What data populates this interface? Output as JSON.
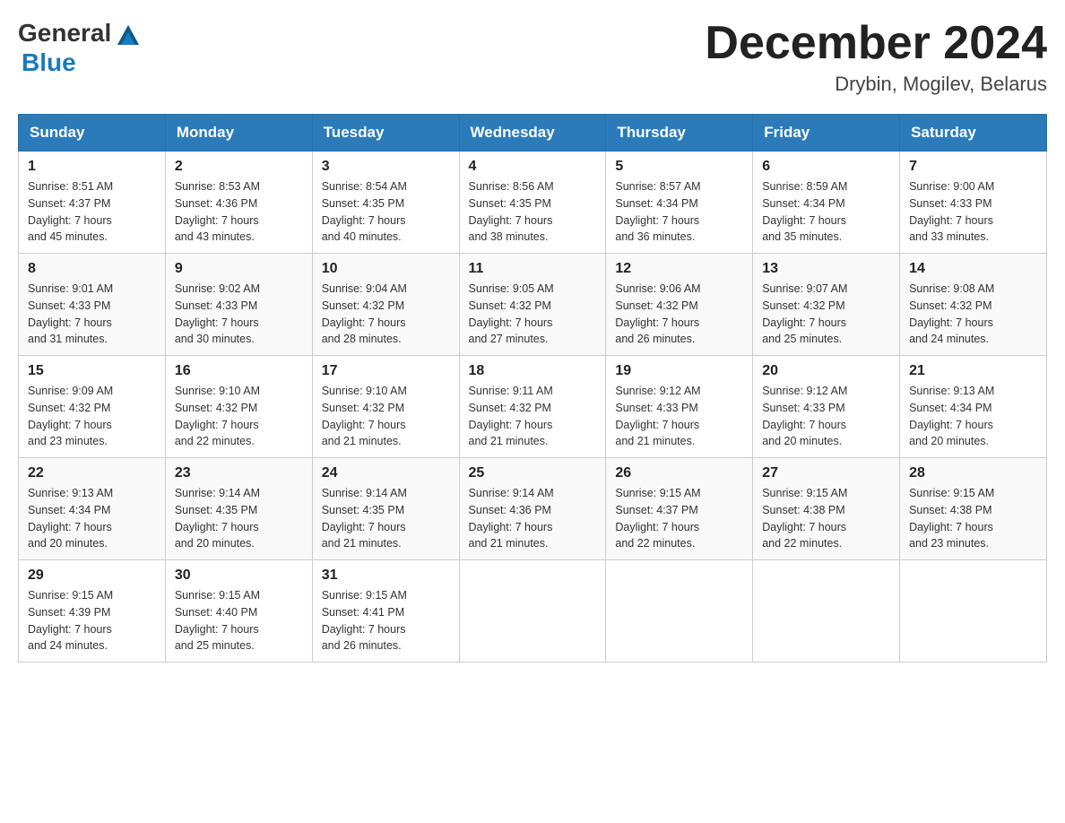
{
  "header": {
    "logo_general": "General",
    "logo_blue": "Blue",
    "month_year": "December 2024",
    "location": "Drybin, Mogilev, Belarus"
  },
  "days_of_week": [
    "Sunday",
    "Monday",
    "Tuesday",
    "Wednesday",
    "Thursday",
    "Friday",
    "Saturday"
  ],
  "weeks": [
    [
      {
        "day": "1",
        "sunrise": "8:51 AM",
        "sunset": "4:37 PM",
        "daylight": "7 hours and 45 minutes."
      },
      {
        "day": "2",
        "sunrise": "8:53 AM",
        "sunset": "4:36 PM",
        "daylight": "7 hours and 43 minutes."
      },
      {
        "day": "3",
        "sunrise": "8:54 AM",
        "sunset": "4:35 PM",
        "daylight": "7 hours and 40 minutes."
      },
      {
        "day": "4",
        "sunrise": "8:56 AM",
        "sunset": "4:35 PM",
        "daylight": "7 hours and 38 minutes."
      },
      {
        "day": "5",
        "sunrise": "8:57 AM",
        "sunset": "4:34 PM",
        "daylight": "7 hours and 36 minutes."
      },
      {
        "day": "6",
        "sunrise": "8:59 AM",
        "sunset": "4:34 PM",
        "daylight": "7 hours and 35 minutes."
      },
      {
        "day": "7",
        "sunrise": "9:00 AM",
        "sunset": "4:33 PM",
        "daylight": "7 hours and 33 minutes."
      }
    ],
    [
      {
        "day": "8",
        "sunrise": "9:01 AM",
        "sunset": "4:33 PM",
        "daylight": "7 hours and 31 minutes."
      },
      {
        "day": "9",
        "sunrise": "9:02 AM",
        "sunset": "4:33 PM",
        "daylight": "7 hours and 30 minutes."
      },
      {
        "day": "10",
        "sunrise": "9:04 AM",
        "sunset": "4:32 PM",
        "daylight": "7 hours and 28 minutes."
      },
      {
        "day": "11",
        "sunrise": "9:05 AM",
        "sunset": "4:32 PM",
        "daylight": "7 hours and 27 minutes."
      },
      {
        "day": "12",
        "sunrise": "9:06 AM",
        "sunset": "4:32 PM",
        "daylight": "7 hours and 26 minutes."
      },
      {
        "day": "13",
        "sunrise": "9:07 AM",
        "sunset": "4:32 PM",
        "daylight": "7 hours and 25 minutes."
      },
      {
        "day": "14",
        "sunrise": "9:08 AM",
        "sunset": "4:32 PM",
        "daylight": "7 hours and 24 minutes."
      }
    ],
    [
      {
        "day": "15",
        "sunrise": "9:09 AM",
        "sunset": "4:32 PM",
        "daylight": "7 hours and 23 minutes."
      },
      {
        "day": "16",
        "sunrise": "9:10 AM",
        "sunset": "4:32 PM",
        "daylight": "7 hours and 22 minutes."
      },
      {
        "day": "17",
        "sunrise": "9:10 AM",
        "sunset": "4:32 PM",
        "daylight": "7 hours and 21 minutes."
      },
      {
        "day": "18",
        "sunrise": "9:11 AM",
        "sunset": "4:32 PM",
        "daylight": "7 hours and 21 minutes."
      },
      {
        "day": "19",
        "sunrise": "9:12 AM",
        "sunset": "4:33 PM",
        "daylight": "7 hours and 21 minutes."
      },
      {
        "day": "20",
        "sunrise": "9:12 AM",
        "sunset": "4:33 PM",
        "daylight": "7 hours and 20 minutes."
      },
      {
        "day": "21",
        "sunrise": "9:13 AM",
        "sunset": "4:34 PM",
        "daylight": "7 hours and 20 minutes."
      }
    ],
    [
      {
        "day": "22",
        "sunrise": "9:13 AM",
        "sunset": "4:34 PM",
        "daylight": "7 hours and 20 minutes."
      },
      {
        "day": "23",
        "sunrise": "9:14 AM",
        "sunset": "4:35 PM",
        "daylight": "7 hours and 20 minutes."
      },
      {
        "day": "24",
        "sunrise": "9:14 AM",
        "sunset": "4:35 PM",
        "daylight": "7 hours and 21 minutes."
      },
      {
        "day": "25",
        "sunrise": "9:14 AM",
        "sunset": "4:36 PM",
        "daylight": "7 hours and 21 minutes."
      },
      {
        "day": "26",
        "sunrise": "9:15 AM",
        "sunset": "4:37 PM",
        "daylight": "7 hours and 22 minutes."
      },
      {
        "day": "27",
        "sunrise": "9:15 AM",
        "sunset": "4:38 PM",
        "daylight": "7 hours and 22 minutes."
      },
      {
        "day": "28",
        "sunrise": "9:15 AM",
        "sunset": "4:38 PM",
        "daylight": "7 hours and 23 minutes."
      }
    ],
    [
      {
        "day": "29",
        "sunrise": "9:15 AM",
        "sunset": "4:39 PM",
        "daylight": "7 hours and 24 minutes."
      },
      {
        "day": "30",
        "sunrise": "9:15 AM",
        "sunset": "4:40 PM",
        "daylight": "7 hours and 25 minutes."
      },
      {
        "day": "31",
        "sunrise": "9:15 AM",
        "sunset": "4:41 PM",
        "daylight": "7 hours and 26 minutes."
      },
      null,
      null,
      null,
      null
    ]
  ]
}
